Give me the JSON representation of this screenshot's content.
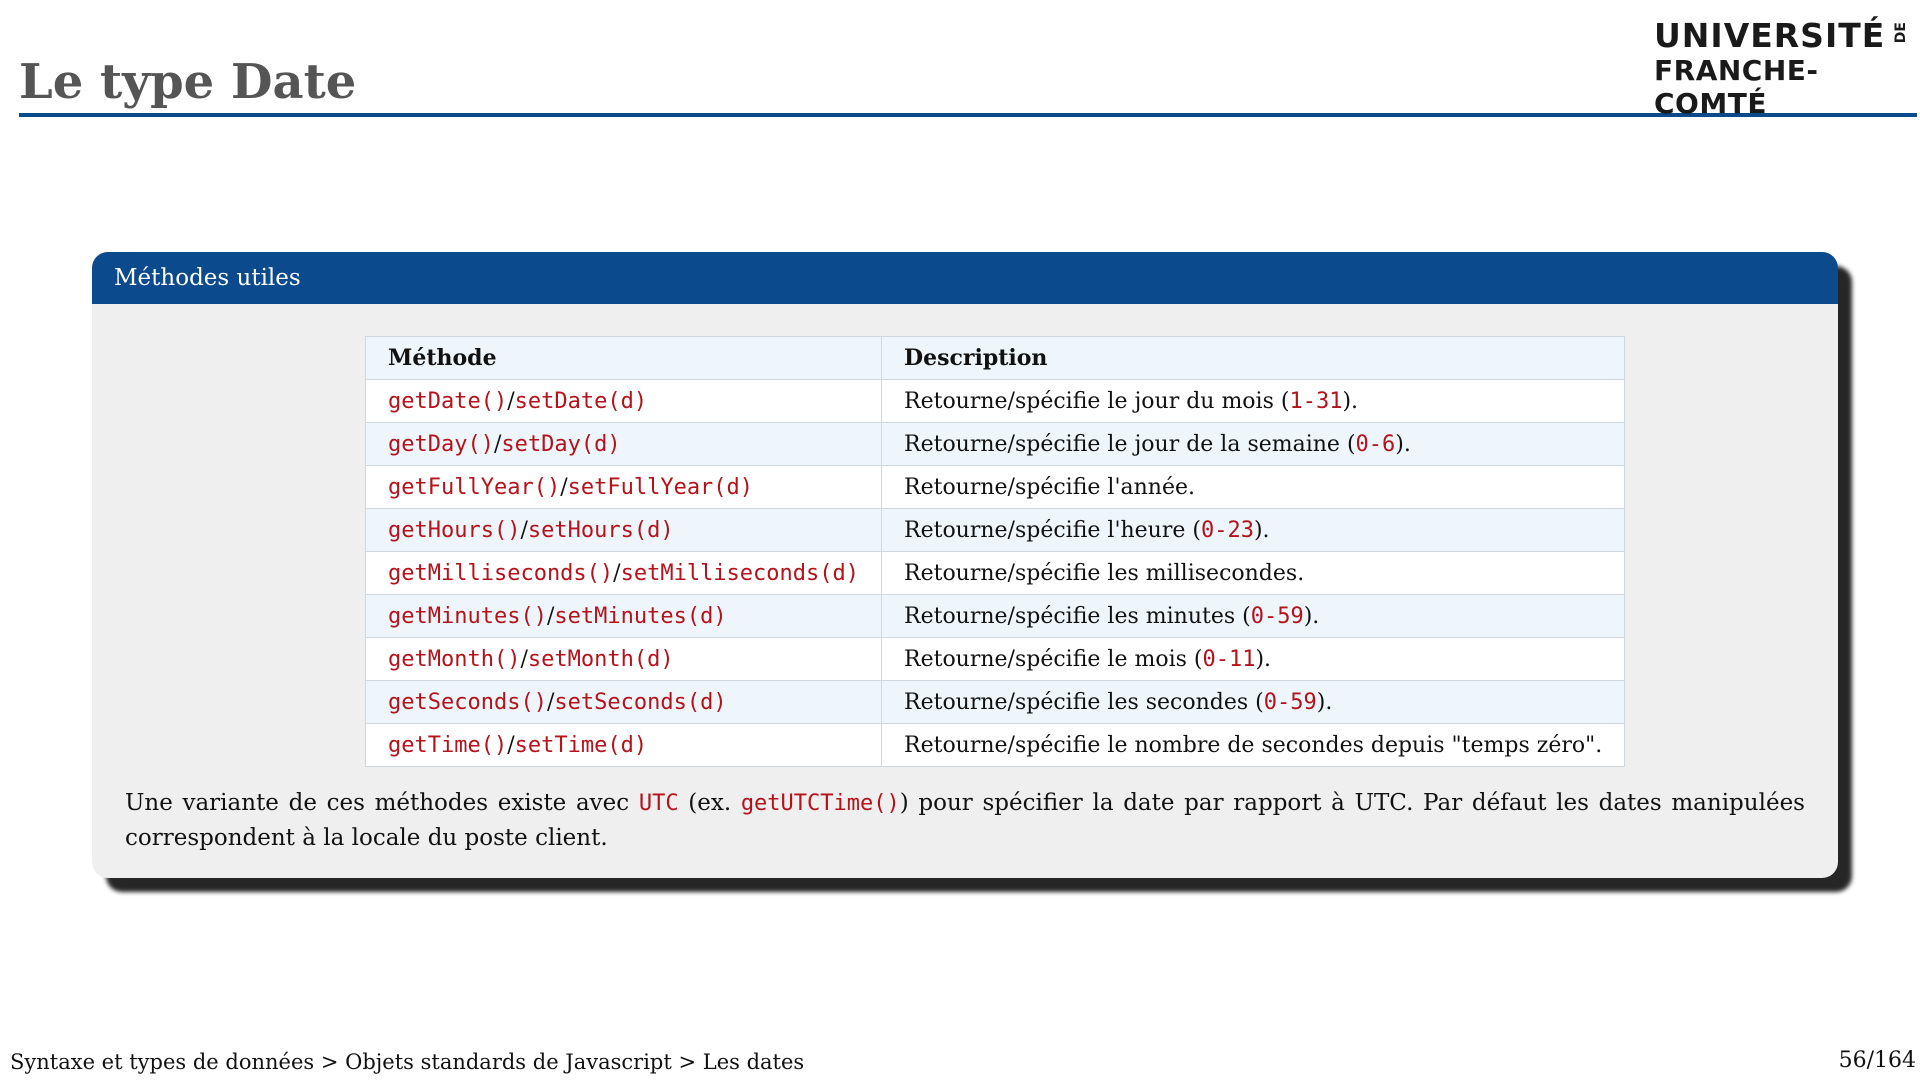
{
  "title": "Le type Date",
  "logo": {
    "line1": "UNIVERSITÉ",
    "line2": "FRANCHE-COMTÉ",
    "de": "DE"
  },
  "block": {
    "header": "Méthodes utiles",
    "table": {
      "headers": [
        "Méthode",
        "Description"
      ],
      "rows": [
        {
          "get": "getDate()",
          "set": "setDate(d)",
          "desc_pre": "Retourne/spécifie le jour du mois (",
          "desc_code": "1-31",
          "desc_post": ")."
        },
        {
          "get": "getDay()",
          "set": "setDay(d)",
          "desc_pre": "Retourne/spécifie le jour de la semaine (",
          "desc_code": "0-6",
          "desc_post": ")."
        },
        {
          "get": "getFullYear()",
          "set": "setFullYear(d)",
          "desc_pre": "Retourne/spécifie l'année.",
          "desc_code": "",
          "desc_post": ""
        },
        {
          "get": "getHours()",
          "set": "setHours(d)",
          "desc_pre": "Retourne/spécifie l'heure (",
          "desc_code": "0-23",
          "desc_post": ")."
        },
        {
          "get": "getMilliseconds()",
          "set": "setMilliseconds(d)",
          "desc_pre": "Retourne/spécifie les millisecondes.",
          "desc_code": "",
          "desc_post": ""
        },
        {
          "get": "getMinutes()",
          "set": "setMinutes(d)",
          "desc_pre": "Retourne/spécifie les minutes (",
          "desc_code": "0-59",
          "desc_post": ")."
        },
        {
          "get": "getMonth()",
          "set": "setMonth(d)",
          "desc_pre": "Retourne/spécifie le mois (",
          "desc_code": "0-11",
          "desc_post": ")."
        },
        {
          "get": "getSeconds()",
          "set": "setSeconds(d)",
          "desc_pre": "Retourne/spécifie les secondes (",
          "desc_code": "0-59",
          "desc_post": ")."
        },
        {
          "get": "getTime()",
          "set": "setTime(d)",
          "desc_pre": "Retourne/spécifie le nombre de secondes depuis \"temps zéro\".",
          "desc_code": "",
          "desc_post": ""
        }
      ]
    },
    "note": {
      "part1": "Une variante de ces méthodes existe avec ",
      "code1": "UTC",
      "part2": " (ex. ",
      "code2": "getUTCTime()",
      "part3": ") pour spécifier la date par rapport à UTC. Par défaut les dates manipulées correspondent à la locale du poste client."
    }
  },
  "footer": {
    "breadcrumb": "Syntaxe et types de données > Objets standards de Javascript > Les dates",
    "page": "56/164"
  },
  "colors": {
    "accent": "#0b4a8c",
    "code": "#b5121b",
    "block_bg": "#efefef",
    "stripe": "#eef6fc"
  }
}
